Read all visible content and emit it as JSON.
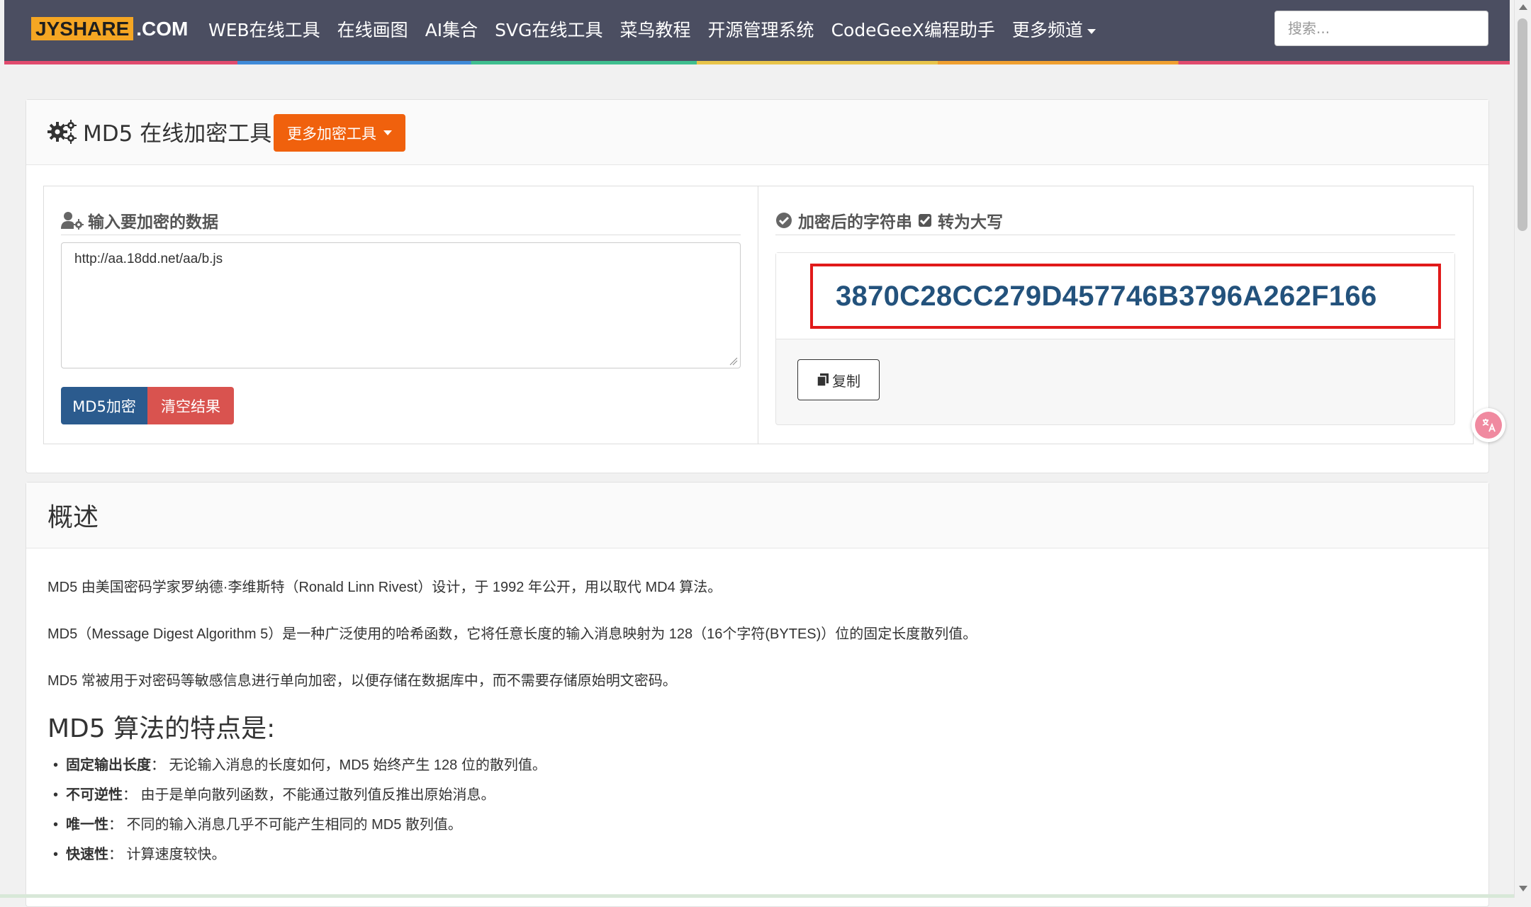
{
  "navbar": {
    "logo_box": "JYSHARE",
    "logo_domain": ".COM",
    "links": [
      "WEB在线工具",
      "在线画图",
      "AI集合",
      "SVG在线工具",
      "菜鸟教程",
      "开源管理系统",
      "CodeGeeX编程助手",
      "更多频道"
    ],
    "search_placeholder": "搜索..."
  },
  "tool": {
    "title": "MD5 在线加密工具",
    "more_button": "更多加密工具",
    "input_heading": "输入要加密的数据",
    "input_value": "http://aa.18dd.net/aa/b.js",
    "encrypt_button": "MD5加密",
    "clear_button": "清空结果",
    "output_heading": "加密后的字符串",
    "uppercase_label": "转为大写",
    "uppercase_checked": true,
    "hash_result": "3870C28CC279D457746B3796A262F166",
    "copy_button": "复制"
  },
  "overview": {
    "title": "概述",
    "paragraphs": [
      "MD5 由美国密码学家罗纳德·李维斯特（Ronald Linn Rivest）设计，于 1992 年公开，用以取代 MD4 算法。",
      "MD5（Message Digest Algorithm 5）是一种广泛使用的哈希函数，它将任意长度的输入消息映射为 128（16个字符(BYTES)）位的固定长度散列值。",
      "MD5 常被用于对密码等敏感信息进行单向加密，以便存储在数据库中，而不需要存储原始明文密码。"
    ],
    "features_title": "MD5 算法的特点是:",
    "features": [
      {
        "term": "固定输出长度",
        "desc": "：  无论输入消息的长度如何，MD5 始终产生 128 位的散列值。"
      },
      {
        "term": "不可逆性",
        "desc": "：  由于是单向散列函数，不能通过散列值反推出原始消息。"
      },
      {
        "term": "唯一性",
        "desc": "：  不同的输入消息几乎不可能产生相同的 MD5 散列值。"
      },
      {
        "term": "快速性",
        "desc": "：  计算速度较快。"
      }
    ]
  },
  "translate_icon": "translate-icon",
  "colors": {
    "navbar": "#4b4e61",
    "orange": "#f0610d",
    "blue": "#2b5b8e",
    "red": "#d9534f",
    "hash_text": "#23527c",
    "highlight": "#e11a1a"
  }
}
